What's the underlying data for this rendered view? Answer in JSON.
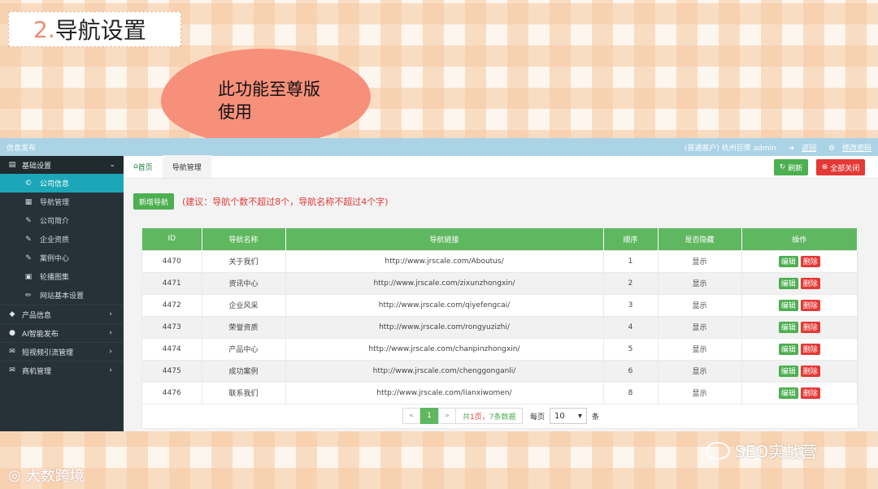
{
  "slide": {
    "title_num": "2.",
    "title_text": "导航设置"
  },
  "callout": {
    "line1": "此功能至尊版",
    "line2": "使用"
  },
  "topbar": {
    "left": "信息发布",
    "user": "(普通客户) 杭州巨荣 admin",
    "back": "返回",
    "change_pwd": "修改密码"
  },
  "sidebar": {
    "section": "基础设置",
    "items": [
      {
        "label": "公司信息",
        "icon": "copyright-icon"
      },
      {
        "label": "导航管理",
        "icon": "grid-icon"
      },
      {
        "label": "公司简介",
        "icon": "edit-icon"
      },
      {
        "label": "企业资质",
        "icon": "edit-icon"
      },
      {
        "label": "案例中心",
        "icon": "edit-icon"
      },
      {
        "label": "轮播图集",
        "icon": "image-icon"
      },
      {
        "label": "网站基本设置",
        "icon": "pencil-icon"
      }
    ],
    "groups": [
      {
        "label": "产品信息",
        "icon": "tag-icon"
      },
      {
        "label": "AI智能发布",
        "icon": "location-icon"
      },
      {
        "label": "短视频引流管理",
        "icon": "mail-icon"
      },
      {
        "label": "商机管理",
        "icon": "mail-icon"
      }
    ]
  },
  "tabs": {
    "home": "首页",
    "current": "导航管理"
  },
  "toolbar": {
    "refresh": "刷新",
    "close_all": "全部关闭",
    "add": "新增导航",
    "hint": "(建议：导航个数不超过8个，导航名称不超过4个字)"
  },
  "table": {
    "headers": [
      "ID",
      "导航名称",
      "导航链接",
      "顺序",
      "是否隐藏",
      "操作"
    ],
    "edit_label": "编辑",
    "delete_label": "删除",
    "rows": [
      {
        "id": "4470",
        "name": "关于我们",
        "link": "http://www.jrscale.com/Aboutus/",
        "order": "1",
        "hidden": "显示"
      },
      {
        "id": "4471",
        "name": "资讯中心",
        "link": "http://www.jrscale.com/zixunzhongxin/",
        "order": "2",
        "hidden": "显示"
      },
      {
        "id": "4472",
        "name": "企业风采",
        "link": "http://www.jrscale.com/qiyefengcai/",
        "order": "3",
        "hidden": "显示"
      },
      {
        "id": "4473",
        "name": "荣誉资质",
        "link": "http://www.jrscale.com/rongyuzizhi/",
        "order": "4",
        "hidden": "显示"
      },
      {
        "id": "4474",
        "name": "产品中心",
        "link": "http://www.jrscale.com/chanpinzhongxin/",
        "order": "5",
        "hidden": "显示"
      },
      {
        "id": "4475",
        "name": "成功案例",
        "link": "http://www.jrscale.com/chenggonganli/",
        "order": "6",
        "hidden": "显示"
      },
      {
        "id": "4476",
        "name": "联系我们",
        "link": "http://www.jrscale.com/lianxiwomen/",
        "order": "8",
        "hidden": "显示"
      }
    ]
  },
  "pager": {
    "prev": "«",
    "page": "1",
    "next": "»",
    "info_a": "共",
    "info_pages": "1页，",
    "info_b": "7条数据",
    "per_label": "每页",
    "per_value": "10",
    "unit": "条"
  },
  "watermarks": {
    "left": "大数跨境",
    "right": "SEO实战营"
  }
}
